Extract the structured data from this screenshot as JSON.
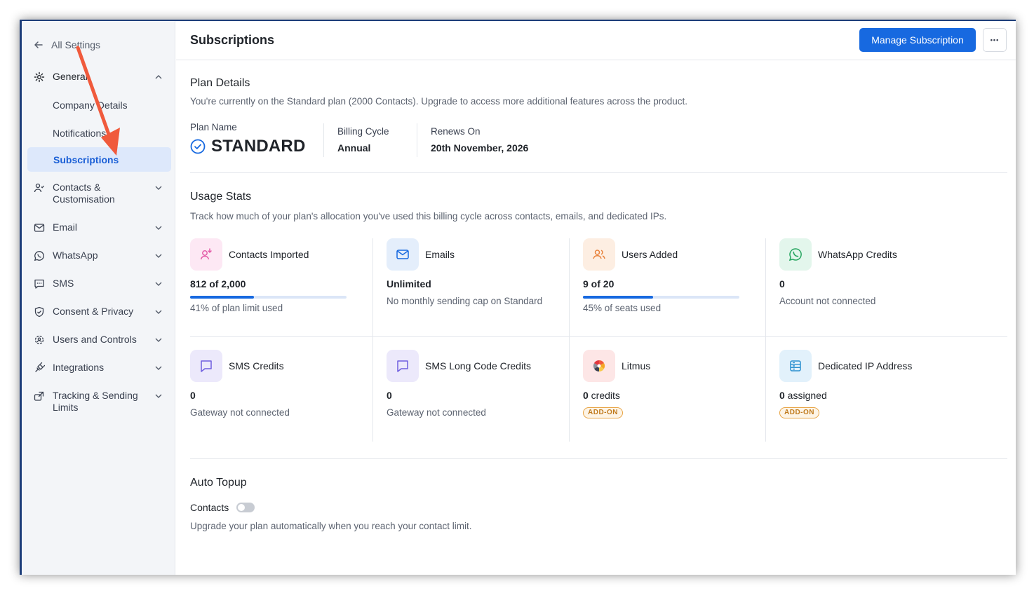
{
  "sidebar": {
    "back_label": "All Settings",
    "general_label": "General",
    "sub_items": [
      "Company Details",
      "Notifications",
      "Subscriptions"
    ],
    "active_sub": "Subscriptions",
    "items": [
      {
        "label_line1": "Contacts &",
        "label_line2": "Customisation",
        "icon": "contacts-icon"
      },
      {
        "label_line1": "Email",
        "icon": "mail-icon"
      },
      {
        "label_line1": "WhatsApp",
        "icon": "whatsapp-icon"
      },
      {
        "label_line1": "SMS",
        "icon": "sms-icon"
      },
      {
        "label_line1": "Consent & Privacy",
        "icon": "shield-icon"
      },
      {
        "label_line1": "Users and Controls",
        "icon": "users-gear-icon"
      },
      {
        "label_line1": "Integrations",
        "icon": "integrations-icon"
      },
      {
        "label_line1": "Tracking & Sending",
        "label_line2": "Limits",
        "icon": "tracking-icon"
      }
    ]
  },
  "header": {
    "title": "Subscriptions",
    "manage_label": "Manage Subscription",
    "more_label": "•••"
  },
  "plan": {
    "title": "Plan Details",
    "desc": "You're currently on the Standard plan (2000 Contacts). Upgrade to access more additional features across the product.",
    "name_label": "Plan Name",
    "name_value": "STANDARD",
    "cycle_label": "Billing Cycle",
    "cycle_value": "Annual",
    "renew_label": "Renews On",
    "renew_value": "20th November, 2026"
  },
  "usage": {
    "title": "Usage Stats",
    "desc": "Track how much of your plan's allocation you've used this billing cycle across contacts, emails, and dedicated IPs.",
    "cards": [
      {
        "name": "Contacts Imported",
        "value": "812 of 2,000",
        "sub": "41% of plan limit used",
        "progress": 0.41
      },
      {
        "name": "Emails",
        "value": "Unlimited",
        "sub": "No monthly sending cap on Standard"
      },
      {
        "name": "Users Added",
        "value": "9 of 20",
        "sub": "45% of seats used",
        "progress": 0.45
      },
      {
        "name": "WhatsApp Credits",
        "value": "0",
        "sub": "Account not connected"
      },
      {
        "name": "SMS Credits",
        "value": "0",
        "sub": "Gateway not connected"
      },
      {
        "name": "SMS Long Code Credits",
        "value": "0",
        "sub": "Gateway not connected"
      },
      {
        "name": "Litmus",
        "value_num": "0",
        "value_unit": " credits",
        "badge": "ADD-ON"
      },
      {
        "name": "Dedicated IP Address",
        "value_num": "0",
        "value_unit": " assigned",
        "badge": "ADD-ON"
      }
    ]
  },
  "autotopup": {
    "title": "Auto Topup",
    "contacts_label": "Contacts",
    "toggle_on": false,
    "desc": "Upgrade your plan automatically when you reach your contact limit."
  },
  "colors": {
    "accent": "#1769e0",
    "active_bg": "#dde8fb",
    "arrow": "#f05a3c"
  }
}
